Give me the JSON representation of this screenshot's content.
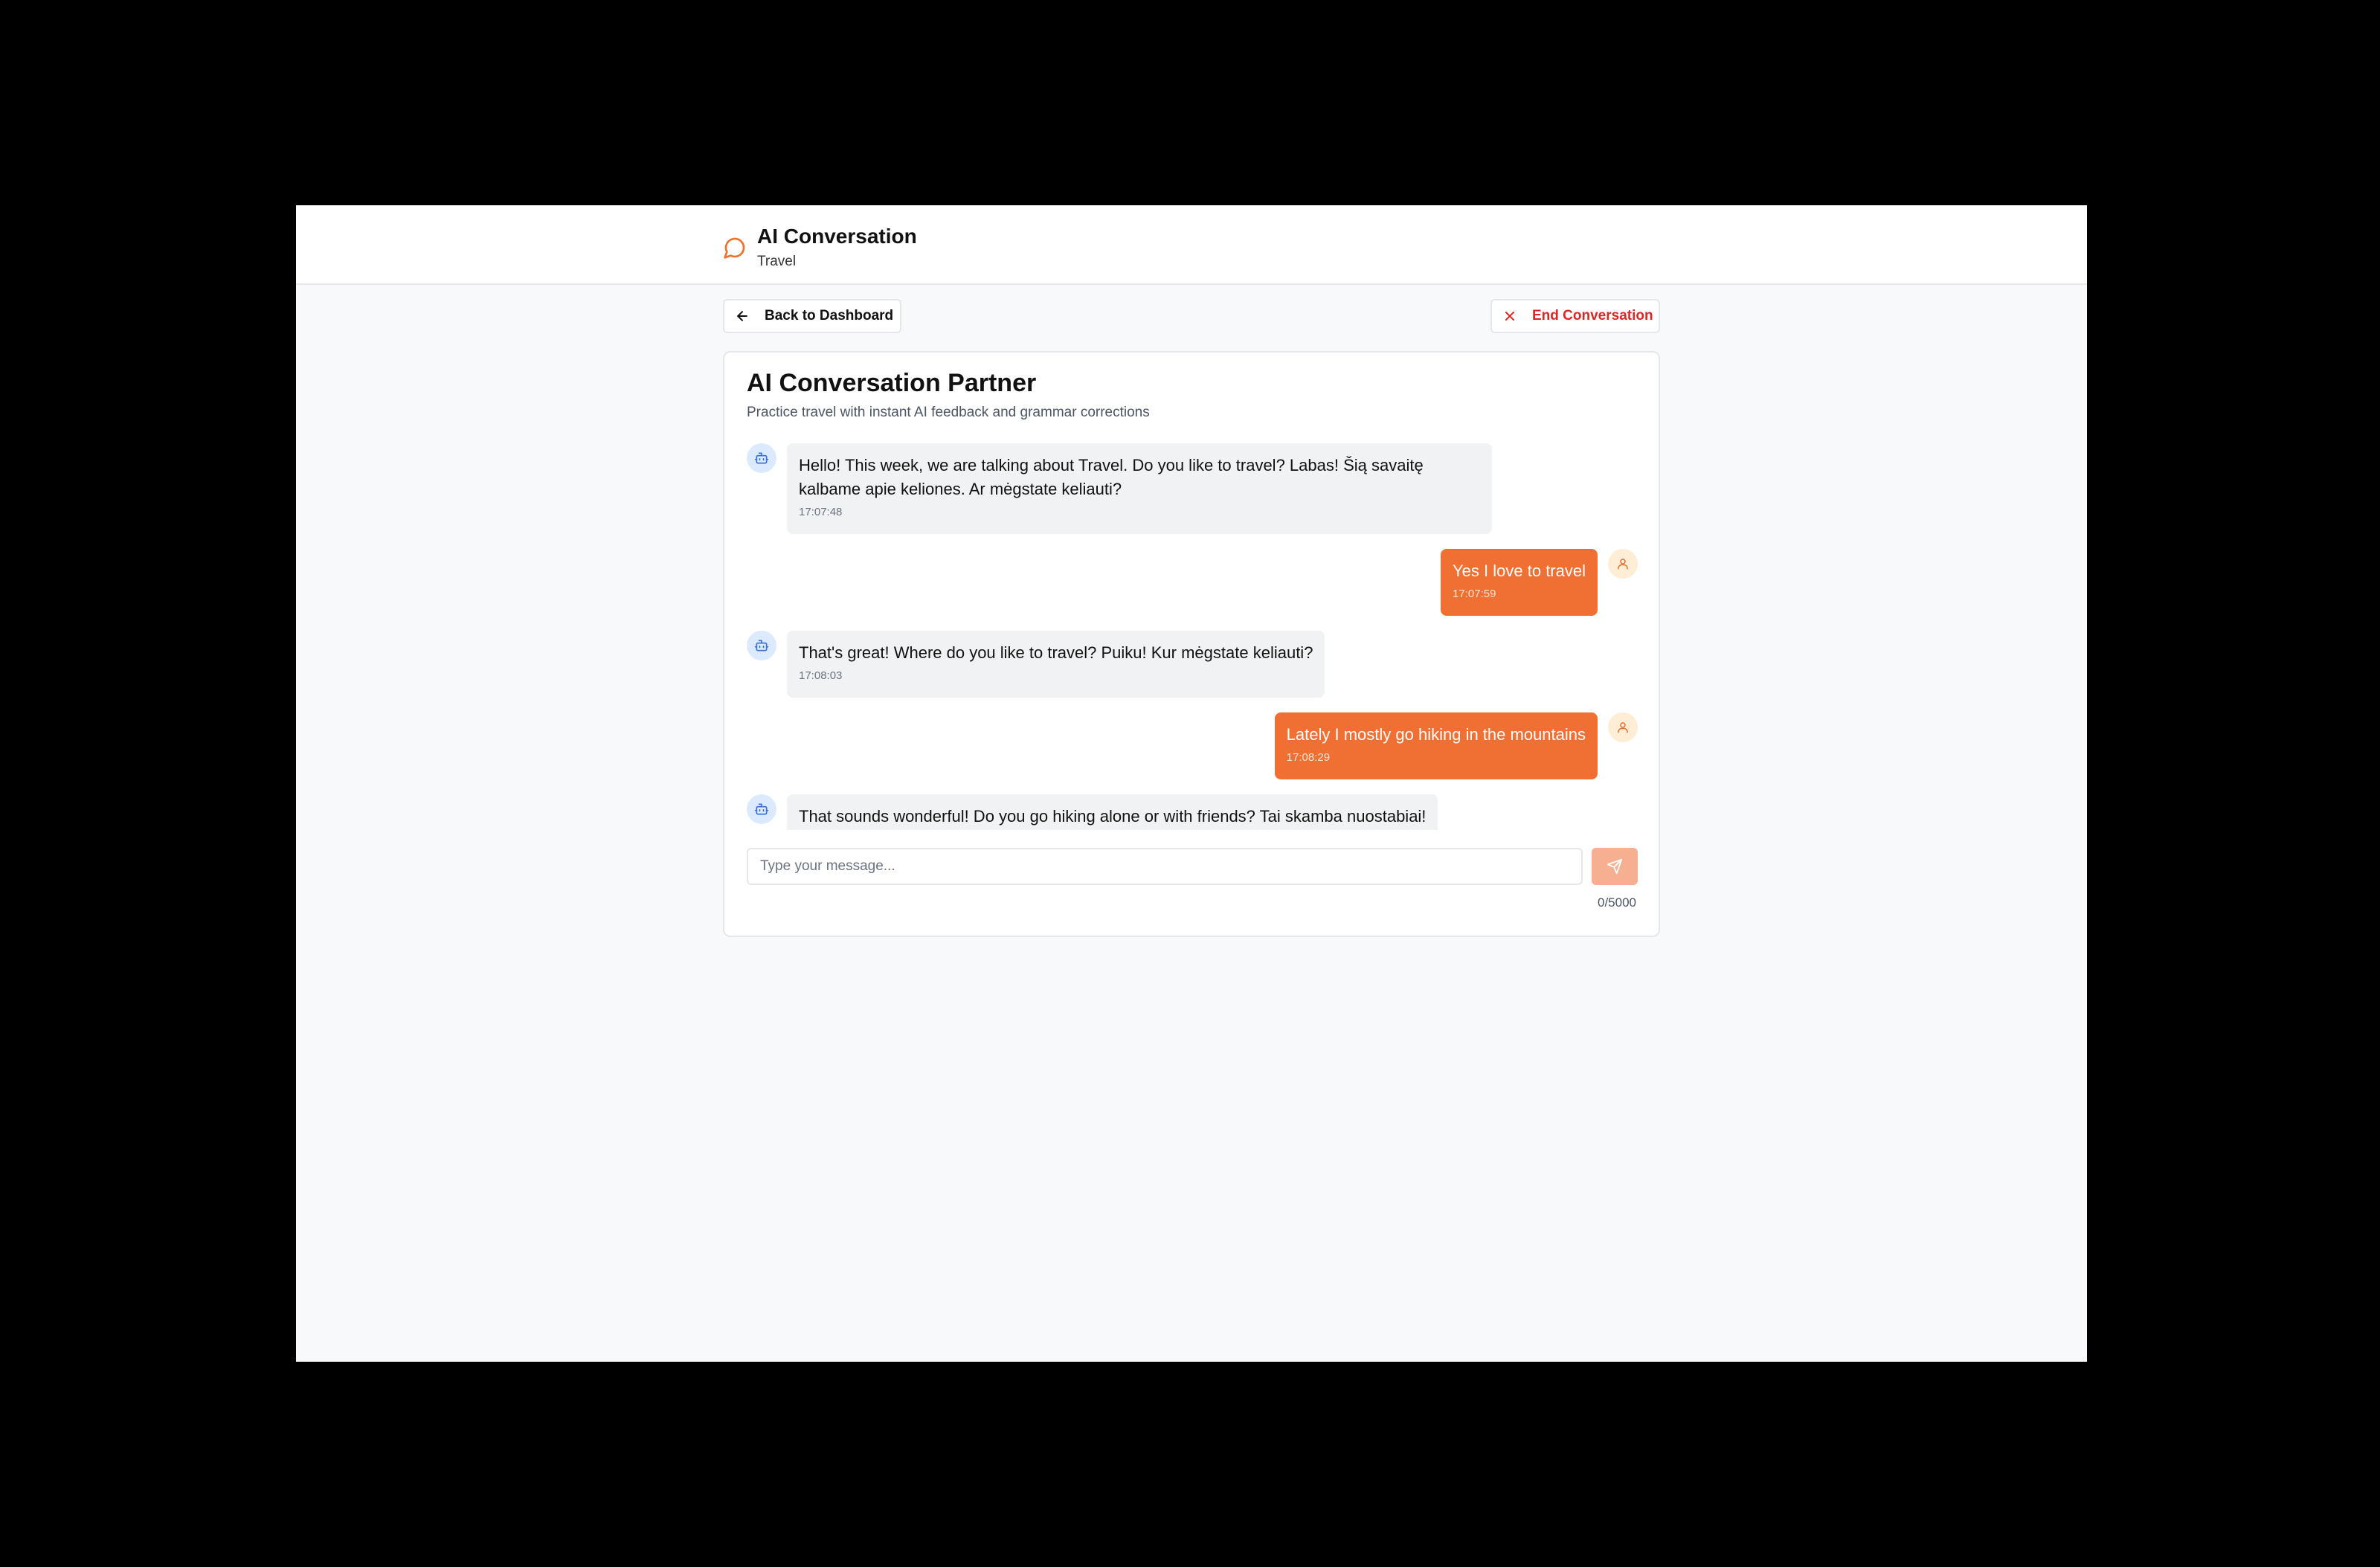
{
  "header": {
    "title": "AI Conversation",
    "subtitle": "Travel",
    "icon": "message-circle-icon"
  },
  "actions": {
    "back_label": "Back to Dashboard",
    "end_label": "End Conversation"
  },
  "colors": {
    "accent": "#f07033",
    "danger": "#dc2626",
    "ai_bubble": "#f1f2f4"
  },
  "chat": {
    "title": "AI Conversation Partner",
    "description": "Practice travel with instant AI feedback and grammar corrections",
    "messages": [
      {
        "role": "ai",
        "text": "Hello! This week, we are talking about Travel. Do you like to travel? Labas! Šią savaitę kalbame apie keliones. Ar mėgstate keliauti?",
        "time": "17:07:48"
      },
      {
        "role": "user",
        "text": "Yes I love to travel",
        "time": "17:07:59"
      },
      {
        "role": "ai",
        "text": "That's great! Where do you like to travel? Puiku! Kur mėgstate keliauti?",
        "time": "17:08:03"
      },
      {
        "role": "user",
        "text": "Lately I mostly go hiking in the mountains",
        "time": "17:08:29"
      },
      {
        "role": "ai",
        "text": "That sounds wonderful! Do you go hiking alone or with friends? Tai skamba nuostabiai!",
        "time": ""
      }
    ]
  },
  "composer": {
    "placeholder": "Type your message...",
    "value": "",
    "char_count": "0/5000"
  }
}
